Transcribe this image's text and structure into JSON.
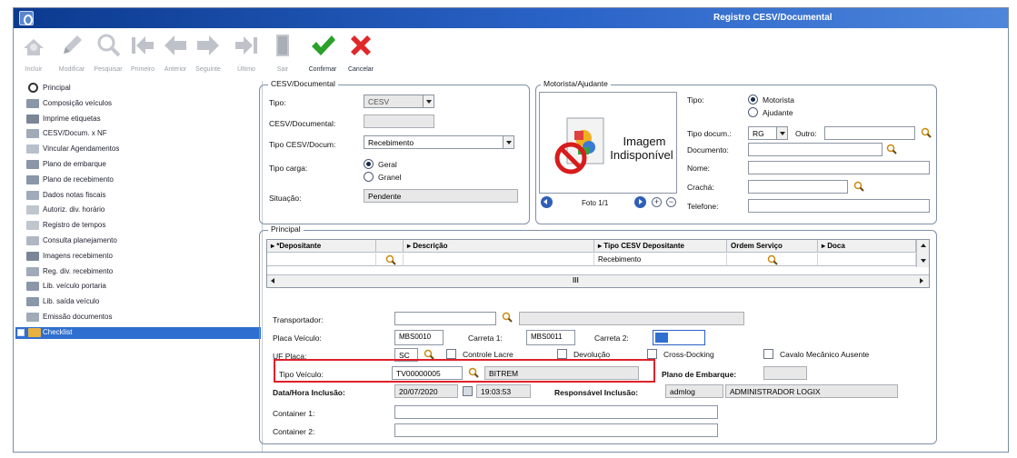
{
  "window": {
    "title": "Registro CESV/Documental"
  },
  "toolbar": [
    {
      "label": "Incluir",
      "enabled": false,
      "icon": "plus-icon"
    },
    {
      "label": "Modificar",
      "enabled": false,
      "icon": "pencil-icon"
    },
    {
      "label": "Pesquisar",
      "enabled": false,
      "icon": "search-icon"
    },
    {
      "label": "Primeiro",
      "enabled": false,
      "icon": "first-arrow-icon"
    },
    {
      "label": "Anterior",
      "enabled": false,
      "icon": "previous-arrow-icon"
    },
    {
      "label": "Seguinte",
      "enabled": false,
      "icon": "next-arrow-icon"
    },
    {
      "label": "Último",
      "enabled": false,
      "icon": "last-arrow-icon"
    },
    {
      "label": "Sair",
      "enabled": false,
      "icon": "exit-door-icon"
    },
    {
      "label": "Confirmar",
      "enabled": true,
      "icon": "check-icon"
    },
    {
      "label": "Cancelar",
      "enabled": true,
      "icon": "cancel-x-icon"
    }
  ],
  "tree": [
    {
      "label": "Principal",
      "icon": "radio-icon"
    },
    {
      "label": "Composição veículos",
      "icon": "truck-icon"
    },
    {
      "label": "Imprime etiquetas",
      "icon": "print-icon"
    },
    {
      "label": "CESV/Docum. x NF",
      "icon": "document-icon"
    },
    {
      "label": "Vincular Agendamentos",
      "icon": "link-icon"
    },
    {
      "label": "Plano de embarque",
      "icon": "truck-icon"
    },
    {
      "label": "Plano de recebimento",
      "icon": "truck-icon"
    },
    {
      "label": "Dados notas fiscais",
      "icon": "document-icon"
    },
    {
      "label": "Autoriz. div. horário",
      "icon": "clock-icon"
    },
    {
      "label": "Registro de tempos",
      "icon": "clock-icon"
    },
    {
      "label": "Consulta planejamento",
      "icon": "chart-icon"
    },
    {
      "label": "Imagens recebimento",
      "icon": "image-icon"
    },
    {
      "label": "Reg. div. recebimento",
      "icon": "document-icon"
    },
    {
      "label": "Lib. veículo portaria",
      "icon": "truck-icon"
    },
    {
      "label": "Lib. saída veículo",
      "icon": "truck-icon"
    },
    {
      "label": "Emissão documentos",
      "icon": "document-icon"
    },
    {
      "label": "Checklist",
      "icon": "checklist-icon",
      "selected": true
    }
  ],
  "cesv": {
    "legend": "CESV/Documental",
    "tipo_label": "Tipo:",
    "tipo_value": "CESV",
    "cesv_label": "CESV/Documental:",
    "cesv_value": "",
    "tipo_cesv_label": "Tipo CESV/Docum:",
    "tipo_cesv_value": "Recebimento",
    "tipo_carga_label": "Tipo carga:",
    "carga_geral": "Geral",
    "carga_granel": "Granel",
    "situacao_label": "Situação:",
    "situacao_value": "Pendente"
  },
  "motorista": {
    "legend": "Motorista/Ajudante",
    "photo_text_1": "Imagem",
    "photo_text_2": "Indisponível",
    "foto_label": "Foto 1/1",
    "tipo_label": "Tipo:",
    "opt_motorista": "Motorista",
    "opt_ajudante": "Ajudante",
    "tipo_docum_label": "Tipo docum.:",
    "tipo_docum_value": "RG",
    "outro_label": "Outro:",
    "documento_label": "Documento:",
    "nome_label": "Nome:",
    "cracha_label": "Crachá:",
    "telefone_label": "Telefone:"
  },
  "principal": {
    "legend": "Principal",
    "grid": {
      "headers": [
        "*Depositante",
        "Descrição",
        "Tipo CESV Depositante",
        "Ordem Serviço",
        "Doca"
      ],
      "row": [
        "",
        "",
        "Recebimento",
        "",
        ""
      ],
      "scroll_glyph": "III"
    },
    "transportador_label": "Transportador:",
    "placa_label": "Placa Veículo:",
    "placa_value": "MBS0010",
    "carreta1_label": "Carreta 1:",
    "carreta1_value": "MBS0011",
    "carreta2_label": "Carreta 2:",
    "uf_label": "UF Placa:",
    "uf_value": "SC",
    "controle_lacre": "Controle Lacre",
    "devolucao": "Devolução",
    "cross_docking": "Cross-Docking",
    "cavalo": "Cavalo Mecânico Ausente",
    "tipo_veiculo_label": "Tipo Veículo:",
    "tipo_veiculo_code": "TV00000005",
    "tipo_veiculo_desc": "BITREM",
    "plano_embarque_label": "Plano de Embarque:",
    "data_hora_label": "Data/Hora Inclusão:",
    "data_value": "20/07/2020",
    "hora_value": "19:03:53",
    "responsavel_label": "Responsável Inclusão:",
    "responsavel_login": "admlog",
    "responsavel_nome": "ADMINISTRADOR LOGIX",
    "container1_label": "Container 1:",
    "container2_label": "Container 2:"
  },
  "colors": {
    "title_bar": "#0b3a8f",
    "selected_item": "#2f6fd0",
    "highlight_box": "#e0202a",
    "confirm": "#2aa12a",
    "cancel": "#e0282a"
  }
}
